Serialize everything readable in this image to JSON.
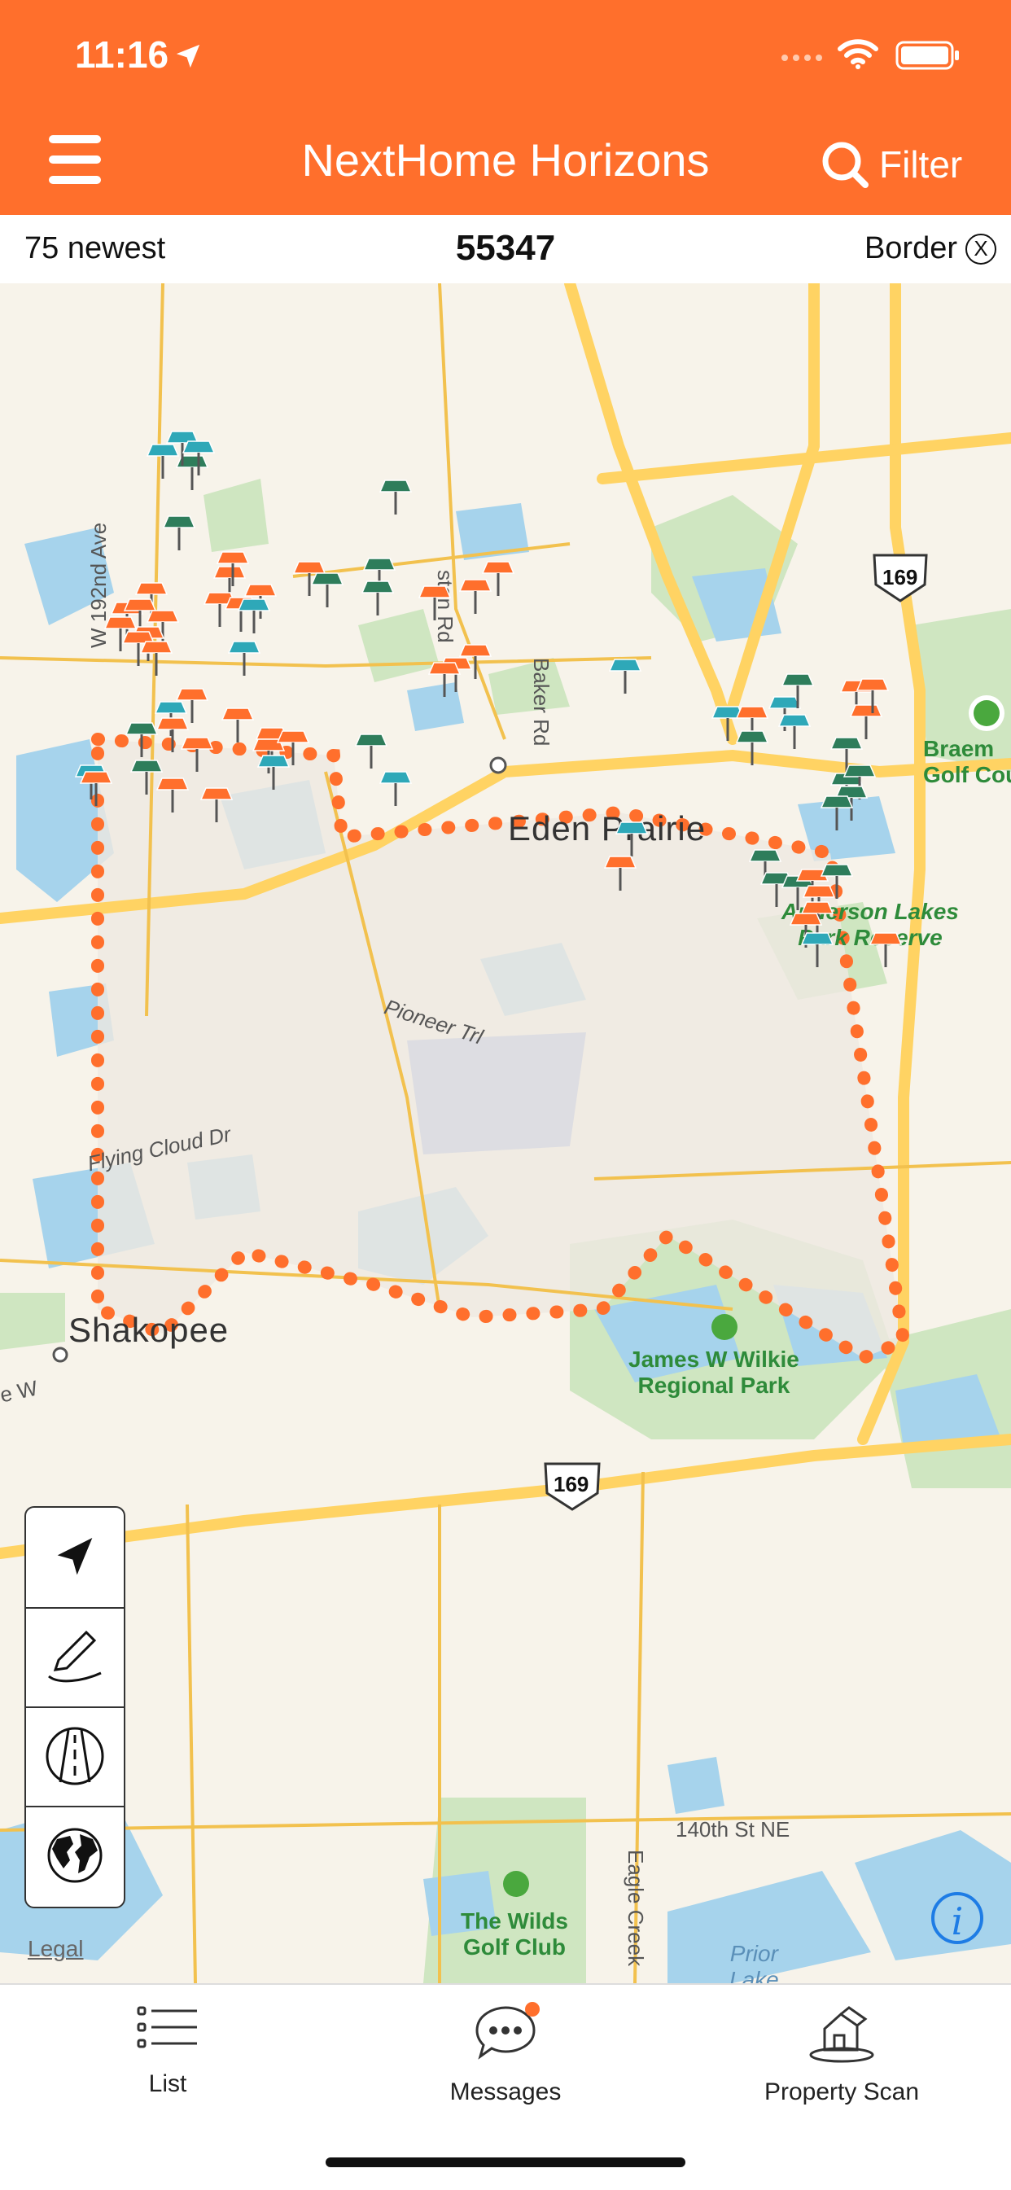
{
  "status_bar": {
    "time": "11:16"
  },
  "header": {
    "title": "NextHome Horizons",
    "filter_label": "Filter"
  },
  "infobar": {
    "count_label": "75 newest",
    "zip": "55347",
    "border_label": "Border",
    "border_close": "X"
  },
  "map": {
    "cities": {
      "eden_prairie": "Eden Prairie",
      "shakopee": "Shakopee"
    },
    "parks": {
      "anderson_lakes": "Anderson Lakes\nPark Reserve",
      "wilkie": "James W Wilkie\nRegional Park",
      "braemar": "Braem\nGolf Cou",
      "wilds": "The Wilds\nGolf Club"
    },
    "roads": {
      "pioneer": "Pioneer Trl",
      "flying_cloud": "Flying Cloud Dr",
      "baker": "Baker Rd",
      "w192": "W 192nd Ave",
      "eden_prairie_rd": "ston Rd",
      "eagle_creek": "Eagle Creek",
      "st140": "140th St NE",
      "hwy169": "169",
      "w_frag": "e W"
    },
    "lakes": {
      "prior": "Prior\nLake"
    },
    "legal": "Legal",
    "pin_colors": {
      "new": "#FF6F2C",
      "pending": "#2EA8B8",
      "active": "#2E7D5B"
    }
  },
  "map_tools": {
    "locate": "location-arrow-icon",
    "draw": "pencil-icon",
    "road": "road-icon",
    "globe": "globe-icon"
  },
  "tabs": [
    {
      "label": "List",
      "icon": "list-icon"
    },
    {
      "label": "Messages",
      "icon": "messages-icon"
    },
    {
      "label": "Property Scan",
      "icon": "house-scan-icon"
    }
  ],
  "colors": {
    "brand": "#FF6F2C",
    "info_blue": "#1E7CE5"
  }
}
